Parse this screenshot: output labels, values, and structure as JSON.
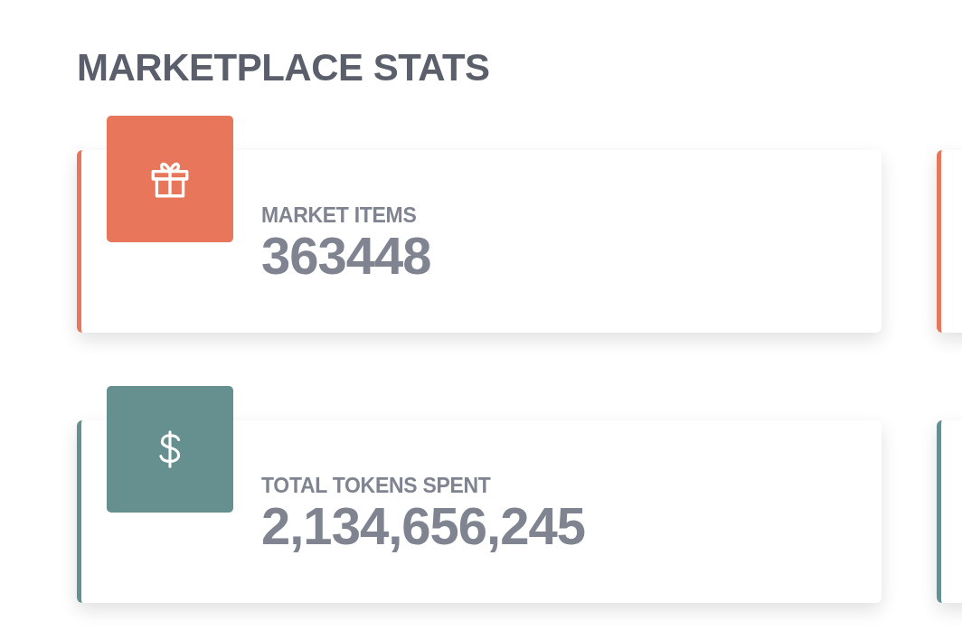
{
  "title": "MARKETPLACE STATS",
  "cards": [
    {
      "kind": "gift",
      "color": "#e8765a",
      "label": "MARKET ITEMS",
      "value": "363448"
    },
    {
      "kind": "dollar",
      "color": "#66908f",
      "label": "TOTAL TOKENS SPENT",
      "value": "2,134,656,245"
    }
  ]
}
